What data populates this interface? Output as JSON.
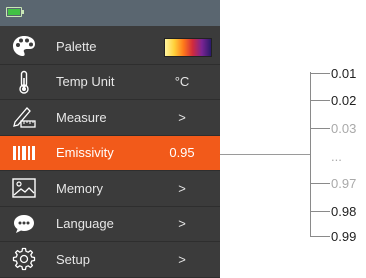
{
  "status": {
    "battery_icon": "battery-icon",
    "battery_color": "#42c244"
  },
  "menu": {
    "items": [
      {
        "id": "palette",
        "icon": "palette-icon",
        "label": "Palette",
        "value": ""
      },
      {
        "id": "temp-unit",
        "icon": "thermometer-icon",
        "label": "Temp Unit",
        "value": "°C"
      },
      {
        "id": "measure",
        "icon": "ruler-pencil-icon",
        "label": "Measure",
        "value": ">"
      },
      {
        "id": "emissivity",
        "icon": "emissivity-icon",
        "label": "Emissivity",
        "value": "0.95"
      },
      {
        "id": "memory",
        "icon": "image-icon",
        "label": "Memory",
        "value": ">"
      },
      {
        "id": "language",
        "icon": "chat-bubble-icon",
        "label": "Language",
        "value": ">"
      },
      {
        "id": "setup",
        "icon": "gear-icon",
        "label": "Setup",
        "value": ">"
      }
    ],
    "active_color": "#f25a1a"
  },
  "emissivity_options": [
    {
      "text": "0.01",
      "state": "normal"
    },
    {
      "text": "0.02",
      "state": "normal"
    },
    {
      "text": "0.03",
      "state": "dim"
    },
    {
      "text": "...",
      "state": "dim"
    },
    {
      "text": "0.97",
      "state": "dim"
    },
    {
      "text": "0.98",
      "state": "normal"
    },
    {
      "text": "0.99",
      "state": "normal"
    }
  ]
}
